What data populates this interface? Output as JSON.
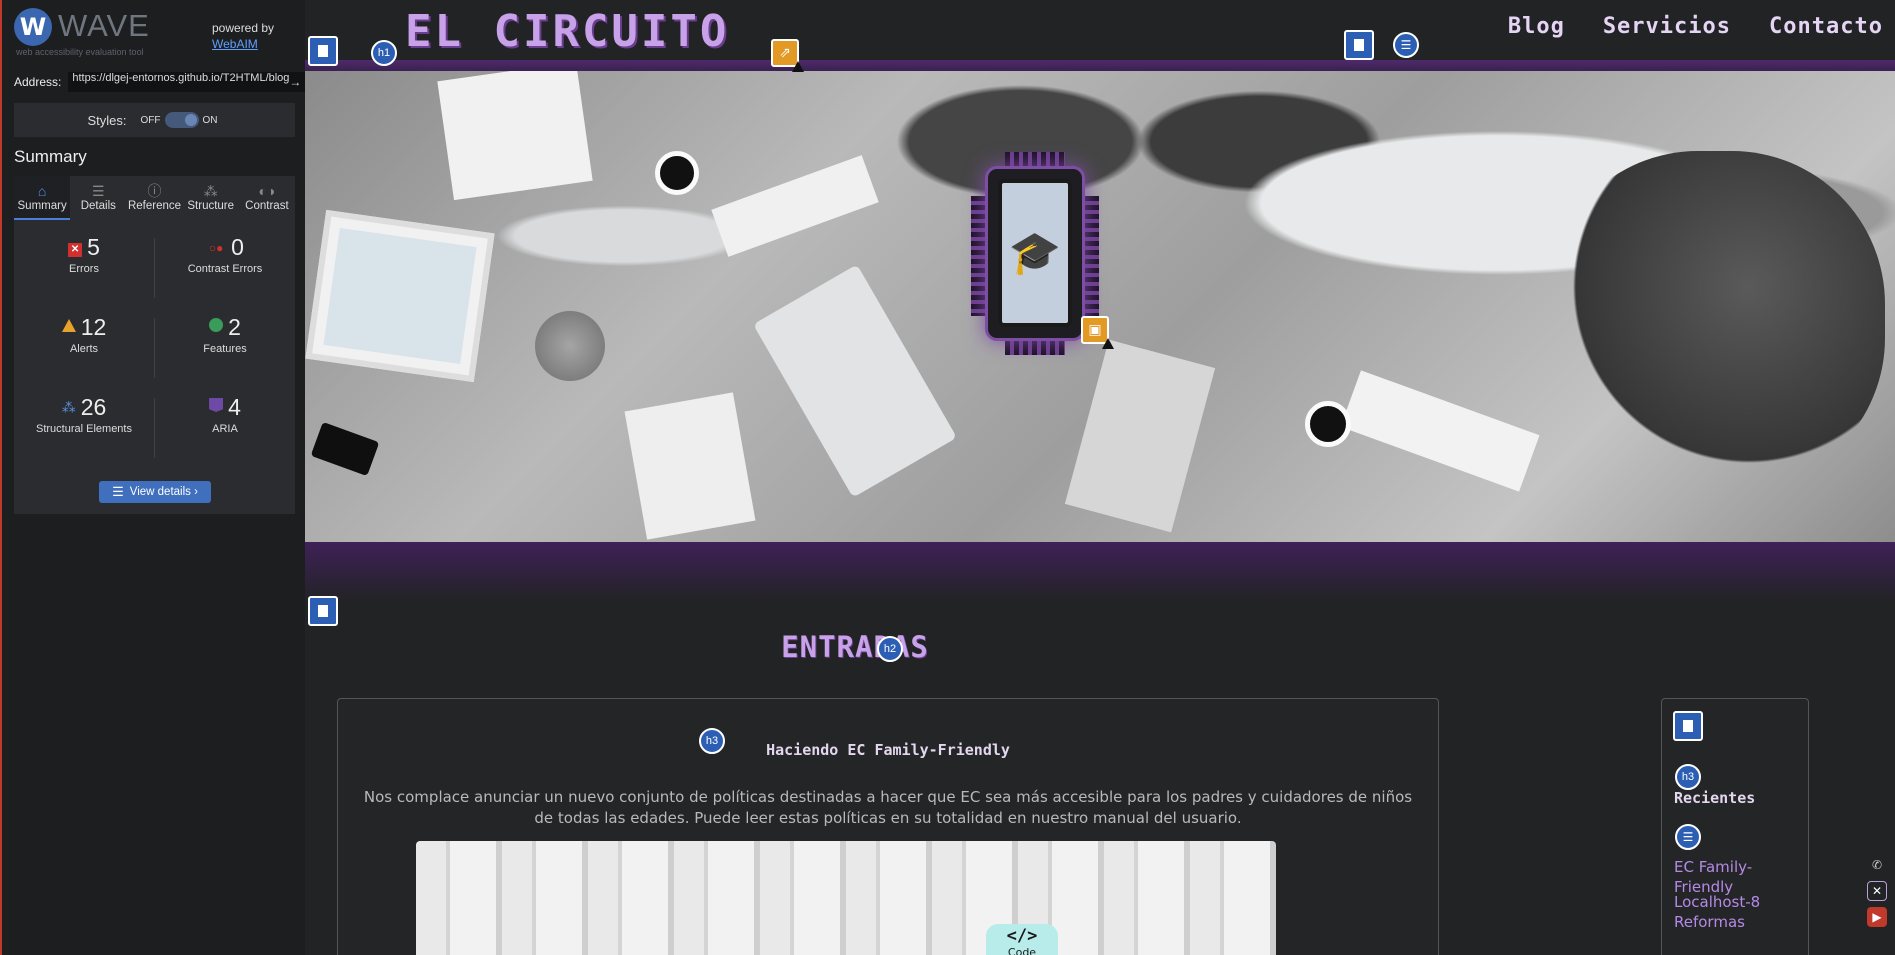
{
  "wave": {
    "logo_letter": "W",
    "name": "WAVE",
    "tagline": "web accessibility evaluation tool",
    "powered_by": "powered by",
    "powered_link": "WebAIM",
    "address_label": "Address:",
    "address_value": "https://dlgej-entornos.github.io/T2HTML/blog",
    "go_icon": "arrow-right-icon",
    "styles_label": "Styles:",
    "styles_off": "OFF",
    "styles_on": "ON",
    "summary_title": "Summary",
    "tabs": [
      {
        "label": "Summary",
        "icon": "home-icon"
      },
      {
        "label": "Details",
        "icon": "list-icon"
      },
      {
        "label": "Reference",
        "icon": "info-icon"
      },
      {
        "label": "Structure",
        "icon": "structure-icon"
      },
      {
        "label": "Contrast",
        "icon": "contrast-icon"
      }
    ],
    "stats": {
      "errors": {
        "value": "5",
        "label": "Errors"
      },
      "contrast_errors": {
        "value": "0",
        "label": "Contrast Errors"
      },
      "alerts": {
        "value": "12",
        "label": "Alerts"
      },
      "features": {
        "value": "2",
        "label": "Features"
      },
      "structural": {
        "value": "26",
        "label": "Structural Elements"
      },
      "aria": {
        "value": "4",
        "label": "ARIA"
      }
    },
    "view_details": "View details ›",
    "accent": "#3f6fbd",
    "error_color": "#d03030",
    "alert_color": "#e6a22a"
  },
  "site": {
    "title": "EL CIRCUITO",
    "nav": [
      "Blog",
      "Servicios",
      "Contacto"
    ],
    "section_title": "ENTRADAS",
    "post": {
      "title": "Haciendo EC Family-Friendly",
      "body": "Nos complace anunciar un nuevo conjunto de políticas destinadas a hacer que EC sea más accesible para los padres y cuidadores de niños de todas las edades. Puede leer estas políticas en su totalidad en nuestro manual del usuario.",
      "code_badge_symbol": "</>",
      "code_badge_label": "Code"
    },
    "aside": {
      "title": "Recientes",
      "links": [
        "EC Family-Friendly",
        "Localhost-8",
        "Reformas"
      ]
    },
    "wave_badges": {
      "h1": "h1",
      "h2": "h2",
      "h3": "h3"
    },
    "brand_color": "#c8a2e8"
  }
}
